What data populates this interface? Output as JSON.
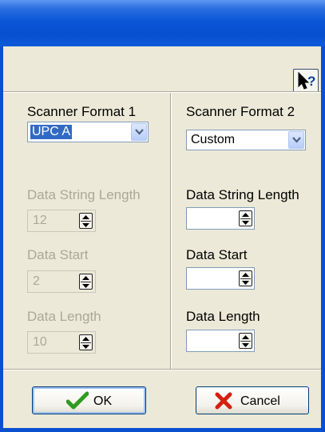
{
  "window": {
    "title": ""
  },
  "help_icon": "help-pointer-icon",
  "left_panel": {
    "heading": "Scanner Format 1",
    "format_value": "UPC A",
    "data_string_length": {
      "label": "Data String Length",
      "value": "12"
    },
    "data_start": {
      "label": "Data Start",
      "value": "2"
    },
    "data_length": {
      "label": "Data Length",
      "value": "10"
    }
  },
  "right_panel": {
    "heading": "Scanner Format 2",
    "format_value": "Custom",
    "data_string_length": {
      "label": "Data String Length",
      "value": ""
    },
    "data_start": {
      "label": "Data Start",
      "value": ""
    },
    "data_length": {
      "label": "Data Length",
      "value": ""
    }
  },
  "buttons": {
    "ok": {
      "label": "OK",
      "icon": "checkmark-icon",
      "icon_color": "#2e9a1e"
    },
    "cancel": {
      "label": "Cancel",
      "icon": "x-icon",
      "icon_color": "#d42010"
    }
  }
}
